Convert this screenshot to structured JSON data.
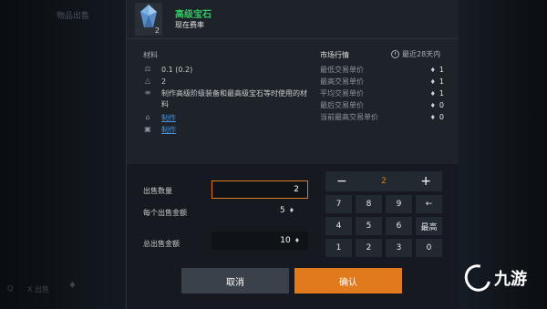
{
  "background": {
    "title": "物品出售",
    "bottom_left_1": "Q",
    "bottom_left_2": "X 出售"
  },
  "item": {
    "name": "高级宝石",
    "subtitle": "现在费率",
    "count": "2"
  },
  "materials": {
    "title": "材料",
    "rows": [
      {
        "icon": "weight-icon",
        "text": "0.1 (0.2)"
      },
      {
        "icon": "stack-icon",
        "text": "2"
      },
      {
        "icon": "description-icon",
        "text": "制作高级阶级装备和最高级宝石等时使用的材料"
      }
    ],
    "links": [
      {
        "icon": "craft-icon",
        "text": "制作"
      },
      {
        "icon": "craft-list-icon",
        "text": "制作"
      }
    ]
  },
  "market": {
    "title": "市场行情",
    "period": "最近28天内",
    "rows": [
      {
        "label": "最低交易单价",
        "value": "1"
      },
      {
        "label": "最高交易单价",
        "value": "1"
      },
      {
        "label": "平均交易单价",
        "value": "1"
      },
      {
        "label": "最后交易单价",
        "value": "0"
      },
      {
        "label": "当前最高交易单价",
        "value": "0"
      }
    ]
  },
  "sale": {
    "qty_label": "出售数量",
    "qty_value": "2",
    "unit_label": "每个出售金额",
    "unit_value": "5",
    "total_label": "总出售金额",
    "total_value": "10"
  },
  "keypad": {
    "minus": "−",
    "plus": "+",
    "display": "2",
    "keys": [
      "7",
      "8",
      "9",
      "←",
      "4",
      "5",
      "6",
      "最高",
      "1",
      "2",
      "3",
      "0"
    ]
  },
  "buttons": {
    "cancel": "取消",
    "confirm": "确认"
  },
  "watermark": {
    "text": "九游"
  },
  "colors": {
    "accent": "#e07a1c",
    "item_name": "#33c764",
    "link": "#4a90e2"
  }
}
